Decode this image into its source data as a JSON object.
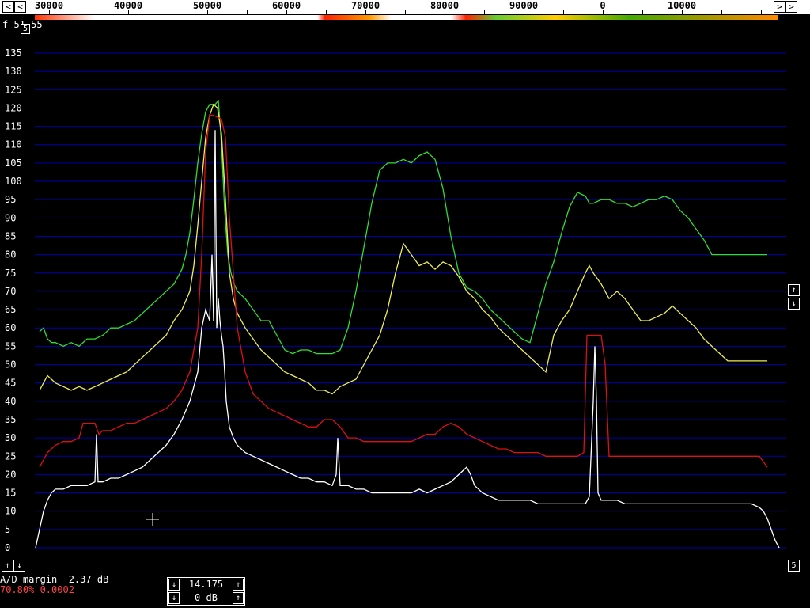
{
  "ruler": {
    "labels": [
      "30000",
      "40000",
      "50000",
      "60000",
      "70000",
      "80000",
      "90000",
      "0",
      "10000"
    ],
    "left_arrow": "<",
    "right_arrow": ">"
  },
  "top_readout": "f 51.55",
  "top_button": "5",
  "y_axis": {
    "labels": [
      "135",
      "130",
      "125",
      "120",
      "115",
      "110",
      "105",
      "100",
      "95",
      "90",
      "85",
      "80",
      "75",
      "70",
      "65",
      "60",
      "55",
      "50",
      "45",
      "40",
      "35",
      "30",
      "25",
      "20",
      "15",
      "10",
      "5",
      "0"
    ]
  },
  "scroll": {
    "up": "↑",
    "down": "↓",
    "right_corner": "5"
  },
  "status": {
    "ad_margin": "A/D margin  2.37 dB",
    "readout": "70.80% 0.0002"
  },
  "center_box": {
    "freq": "14.175",
    "gain": "0 dB",
    "up": "↑",
    "down": "↓"
  },
  "colors": {
    "grid": "#0000aa",
    "trace_green": "#33dd33",
    "trace_yellow": "#eeee55",
    "trace_red": "#dd1111",
    "trace_white": "#ffffff"
  },
  "chart_data": {
    "type": "line",
    "ylim": [
      0,
      135
    ],
    "series": [
      {
        "x": [
          50,
          55,
          60,
          65,
          70,
          80,
          90,
          100,
          110,
          120,
          130,
          140,
          150,
          160,
          170,
          180,
          190,
          200,
          210,
          220,
          230,
          235,
          240,
          245,
          250,
          255,
          260,
          265,
          268,
          272,
          276,
          280,
          284,
          288,
          292,
          296,
          300,
          310,
          320,
          330,
          340,
          350,
          360,
          370,
          380,
          390,
          400,
          410,
          420,
          430,
          440,
          450,
          460,
          470,
          480,
          490,
          500,
          510,
          520,
          530,
          540,
          550,
          560,
          570,
          580,
          590,
          600,
          610,
          620,
          630,
          640,
          650,
          660,
          670,
          680,
          690,
          700,
          710,
          720,
          730,
          740,
          745,
          750,
          760,
          770,
          780,
          790,
          800,
          810,
          820,
          830,
          840,
          850,
          860,
          870,
          880,
          890,
          900,
          910,
          920,
          930,
          940,
          950,
          960,
          970
        ],
        "y": [
          59,
          60,
          57,
          56,
          56,
          55,
          56,
          55,
          57,
          57,
          58,
          60,
          60,
          61,
          62,
          64,
          66,
          68,
          70,
          72,
          76,
          80,
          86,
          95,
          105,
          113,
          119,
          121,
          121,
          121,
          122,
          110,
          92,
          80,
          75,
          72,
          70,
          68,
          65,
          62,
          62,
          58,
          54,
          53,
          54,
          54,
          53,
          53,
          53,
          54,
          60,
          70,
          82,
          94,
          103,
          105,
          105,
          106,
          105,
          107,
          108,
          106,
          98,
          85,
          75,
          71,
          70,
          68,
          65,
          63,
          61,
          59,
          57,
          56,
          64,
          72,
          78,
          86,
          93,
          97,
          96,
          94,
          94,
          95,
          95,
          94,
          94,
          93,
          94,
          95,
          95,
          96,
          95,
          92,
          90,
          87,
          84,
          80,
          80,
          80,
          80,
          80,
          80,
          80,
          80
        ],
        "color": "#33dd33"
      },
      {
        "x": [
          50,
          55,
          60,
          65,
          70,
          80,
          90,
          100,
          110,
          120,
          130,
          140,
          150,
          160,
          170,
          180,
          190,
          200,
          210,
          220,
          230,
          240,
          245,
          250,
          255,
          260,
          265,
          270,
          275,
          280,
          285,
          290,
          295,
          300,
          310,
          320,
          330,
          340,
          350,
          360,
          370,
          380,
          390,
          400,
          410,
          420,
          430,
          440,
          450,
          460,
          470,
          480,
          490,
          500,
          510,
          520,
          530,
          540,
          550,
          560,
          570,
          580,
          590,
          600,
          610,
          620,
          630,
          640,
          650,
          660,
          670,
          680,
          690,
          700,
          710,
          720,
          730,
          740,
          745,
          750,
          760,
          770,
          780,
          790,
          800,
          810,
          820,
          830,
          840,
          850,
          860,
          870,
          880,
          890,
          900,
          910,
          920,
          930,
          940,
          950,
          960,
          970
        ],
        "y": [
          43,
          45,
          47,
          46,
          45,
          44,
          43,
          44,
          43,
          44,
          45,
          46,
          47,
          48,
          50,
          52,
          54,
          56,
          58,
          62,
          65,
          70,
          77,
          88,
          100,
          112,
          118,
          121,
          120,
          113,
          95,
          75,
          68,
          64,
          60,
          57,
          54,
          52,
          50,
          48,
          47,
          46,
          45,
          43,
          43,
          42,
          44,
          45,
          46,
          50,
          54,
          58,
          65,
          75,
          83,
          80,
          77,
          78,
          76,
          78,
          77,
          74,
          70,
          68,
          65,
          63,
          60,
          58,
          56,
          54,
          52,
          50,
          48,
          58,
          62,
          65,
          70,
          75,
          77,
          75,
          72,
          68,
          70,
          68,
          65,
          62,
          62,
          63,
          64,
          66,
          64,
          62,
          60,
          57,
          55,
          53,
          51,
          51,
          51,
          51,
          51,
          51
        ],
        "color": "#eeee55"
      },
      {
        "x": [
          50,
          55,
          60,
          65,
          70,
          80,
          90,
          100,
          105,
          110,
          120,
          125,
          130,
          140,
          150,
          160,
          170,
          180,
          190,
          200,
          210,
          220,
          230,
          240,
          250,
          255,
          260,
          265,
          270,
          280,
          285,
          290,
          300,
          310,
          320,
          330,
          340,
          350,
          360,
          370,
          380,
          390,
          400,
          410,
          420,
          430,
          440,
          450,
          460,
          470,
          480,
          490,
          500,
          510,
          520,
          530,
          540,
          550,
          560,
          570,
          580,
          590,
          600,
          610,
          620,
          630,
          640,
          650,
          660,
          670,
          680,
          690,
          700,
          710,
          720,
          730,
          738,
          742,
          746,
          750,
          755,
          760,
          765,
          770,
          780,
          790,
          800,
          810,
          820,
          830,
          840,
          850,
          860,
          870,
          880,
          890,
          900,
          910,
          920,
          930,
          940,
          950,
          960,
          970
        ],
        "y": [
          22,
          24,
          26,
          27,
          28,
          29,
          29,
          30,
          34,
          34,
          34,
          31,
          32,
          32,
          33,
          34,
          34,
          35,
          36,
          37,
          38,
          40,
          43,
          48,
          60,
          80,
          108,
          118,
          118,
          117,
          112,
          90,
          60,
          48,
          42,
          40,
          38,
          37,
          36,
          35,
          34,
          33,
          33,
          35,
          35,
          33,
          30,
          30,
          29,
          29,
          29,
          29,
          29,
          29,
          29,
          30,
          31,
          31,
          33,
          34,
          33,
          31,
          30,
          29,
          28,
          27,
          27,
          26,
          26,
          26,
          26,
          25,
          25,
          25,
          25,
          25,
          26,
          58,
          58,
          58,
          58,
          58,
          50,
          25,
          25,
          25,
          25,
          25,
          25,
          25,
          25,
          25,
          25,
          25,
          25,
          25,
          25,
          25,
          25,
          25,
          25,
          25,
          25,
          22
        ],
        "color": "#dd1111"
      },
      {
        "x": [
          45,
          50,
          55,
          60,
          65,
          70,
          80,
          90,
          100,
          110,
          120,
          122,
          124,
          130,
          140,
          150,
          160,
          170,
          180,
          190,
          200,
          210,
          220,
          230,
          240,
          250,
          255,
          260,
          265,
          268,
          270,
          272,
          274,
          276,
          278,
          280,
          282,
          284,
          286,
          290,
          295,
          300,
          310,
          320,
          330,
          340,
          350,
          360,
          370,
          380,
          390,
          400,
          410,
          420,
          425,
          427,
          430,
          440,
          450,
          460,
          470,
          480,
          490,
          500,
          510,
          520,
          530,
          540,
          550,
          560,
          570,
          580,
          590,
          595,
          600,
          610,
          620,
          630,
          640,
          650,
          660,
          670,
          680,
          690,
          700,
          710,
          720,
          730,
          740,
          745,
          750,
          752,
          754,
          756,
          758,
          760,
          765,
          770,
          780,
          790,
          800,
          810,
          820,
          830,
          840,
          850,
          860,
          870,
          880,
          890,
          900,
          910,
          920,
          930,
          940,
          950,
          960,
          965,
          970,
          975,
          980,
          985
        ],
        "y": [
          0,
          5,
          10,
          13,
          15,
          16,
          16,
          17,
          17,
          17,
          18,
          31,
          18,
          18,
          19,
          19,
          20,
          21,
          22,
          24,
          26,
          28,
          31,
          35,
          40,
          48,
          60,
          65,
          62,
          80,
          62,
          114,
          60,
          68,
          62,
          58,
          55,
          48,
          40,
          33,
          30,
          28,
          26,
          25,
          24,
          23,
          22,
          21,
          20,
          19,
          19,
          18,
          18,
          17,
          20,
          30,
          17,
          17,
          16,
          16,
          15,
          15,
          15,
          15,
          15,
          15,
          16,
          15,
          16,
          17,
          18,
          20,
          22,
          20,
          17,
          15,
          14,
          13,
          13,
          13,
          13,
          13,
          12,
          12,
          12,
          12,
          12,
          12,
          12,
          14,
          40,
          55,
          40,
          15,
          14,
          13,
          13,
          13,
          13,
          12,
          12,
          12,
          12,
          12,
          12,
          12,
          12,
          12,
          12,
          12,
          12,
          12,
          12,
          12,
          12,
          12,
          11,
          10,
          8,
          5,
          2,
          0
        ],
        "color": "#ffffff"
      }
    ]
  }
}
